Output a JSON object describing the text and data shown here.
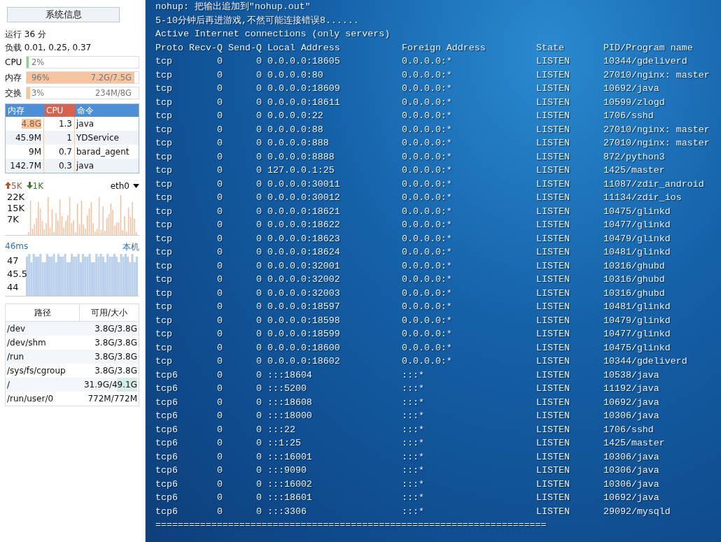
{
  "sidebar": {
    "title_button": "系统信息",
    "uptime": "运行 36 分",
    "load": "负载 0.01, 0.25, 0.37",
    "meters": [
      {
        "label": "CPU",
        "percent": "2%",
        "level": 0.02,
        "color": "#8fd08f"
      },
      {
        "label": "内存",
        "percent": "96%",
        "detail": "7.2G/7.5G",
        "level": 0.96,
        "color": "#f6c49e"
      },
      {
        "label": "交换",
        "percent": "3%",
        "detail": "234M/8G",
        "level": 0.03,
        "color": "#f6c49e"
      }
    ],
    "process_table": {
      "columns": [
        "内存",
        "CPU",
        "命令"
      ],
      "rows": [
        {
          "mem": "4.8G",
          "cpu": "1.3",
          "command": "java",
          "highlighted": true
        },
        {
          "mem": "45.9M",
          "cpu": "1",
          "command": "YDService",
          "highlighted": false
        },
        {
          "mem": "9M",
          "cpu": "0.7",
          "command": "barad_agent",
          "highlighted": false
        },
        {
          "mem": "142.7M",
          "cpu": "0.3",
          "command": "java",
          "highlighted": false
        }
      ]
    },
    "network": {
      "upload": "5K",
      "download": "1K",
      "interface": "eth0",
      "y_labels": [
        "22K",
        "15K",
        "7K"
      ]
    },
    "latency": {
      "value": "46ms",
      "host": "本机",
      "y_labels": [
        "47",
        "45.5",
        "44"
      ]
    },
    "disk_table": {
      "columns": [
        "路径",
        "可用/大小"
      ],
      "rows": [
        {
          "path": "/dev",
          "usage": "3.8G/3.8G",
          "highlighted": false
        },
        {
          "path": "/dev/shm",
          "usage": "3.8G/3.8G",
          "highlighted": false
        },
        {
          "path": "/run",
          "usage": "3.8G/3.8G",
          "highlighted": false
        },
        {
          "path": "/sys/fs/cgroup",
          "usage": "3.8G/3.8G",
          "highlighted": false
        },
        {
          "path": "/",
          "usage": "31.9G/49.1G",
          "highlighted": true
        },
        {
          "path": "/run/user/0",
          "usage": "772M/772M",
          "highlighted": false
        }
      ]
    }
  },
  "terminal": {
    "lines": [
      "nohup: 把输出追加到\"nohup.out\"",
      "5-10分钟后再进游戏,不然可能连接错误8......",
      "Active Internet connections (only servers)"
    ],
    "columns": [
      "Proto",
      "Recv-Q",
      "Send-Q",
      "Local Address",
      "Foreign Address",
      "State",
      "PID/Program name"
    ],
    "rows": [
      [
        "tcp",
        "0",
        "0",
        "0.0.0.0:18605",
        "0.0.0.0:*",
        "LISTEN",
        "10344/gdeliverd"
      ],
      [
        "tcp",
        "0",
        "0",
        "0.0.0.0:80",
        "0.0.0.0:*",
        "LISTEN",
        "27010/nginx: master"
      ],
      [
        "tcp",
        "0",
        "0",
        "0.0.0.0:18609",
        "0.0.0.0:*",
        "LISTEN",
        "10692/java"
      ],
      [
        "tcp",
        "0",
        "0",
        "0.0.0.0:18611",
        "0.0.0.0:*",
        "LISTEN",
        "10599/zlogd"
      ],
      [
        "tcp",
        "0",
        "0",
        "0.0.0.0:22",
        "0.0.0.0:*",
        "LISTEN",
        "1706/sshd"
      ],
      [
        "tcp",
        "0",
        "0",
        "0.0.0.0:88",
        "0.0.0.0:*",
        "LISTEN",
        "27010/nginx: master"
      ],
      [
        "tcp",
        "0",
        "0",
        "0.0.0.0:888",
        "0.0.0.0:*",
        "LISTEN",
        "27010/nginx: master"
      ],
      [
        "tcp",
        "0",
        "0",
        "0.0.0.0:8888",
        "0.0.0.0:*",
        "LISTEN",
        "872/python3"
      ],
      [
        "tcp",
        "0",
        "0",
        "127.0.0.1:25",
        "0.0.0.0:*",
        "LISTEN",
        "1425/master"
      ],
      [
        "tcp",
        "0",
        "0",
        "0.0.0.0:30011",
        "0.0.0.0:*",
        "LISTEN",
        "11087/zdir_android"
      ],
      [
        "tcp",
        "0",
        "0",
        "0.0.0.0:30012",
        "0.0.0.0:*",
        "LISTEN",
        "11134/zdir_ios"
      ],
      [
        "tcp",
        "0",
        "0",
        "0.0.0.0:18621",
        "0.0.0.0:*",
        "LISTEN",
        "10475/glinkd"
      ],
      [
        "tcp",
        "0",
        "0",
        "0.0.0.0:18622",
        "0.0.0.0:*",
        "LISTEN",
        "10477/glinkd"
      ],
      [
        "tcp",
        "0",
        "0",
        "0.0.0.0:18623",
        "0.0.0.0:*",
        "LISTEN",
        "10479/glinkd"
      ],
      [
        "tcp",
        "0",
        "0",
        "0.0.0.0:18624",
        "0.0.0.0:*",
        "LISTEN",
        "10481/glinkd"
      ],
      [
        "tcp",
        "0",
        "0",
        "0.0.0.0:32001",
        "0.0.0.0:*",
        "LISTEN",
        "10316/ghubd"
      ],
      [
        "tcp",
        "0",
        "0",
        "0.0.0.0:32002",
        "0.0.0.0:*",
        "LISTEN",
        "10316/ghubd"
      ],
      [
        "tcp",
        "0",
        "0",
        "0.0.0.0:32003",
        "0.0.0.0:*",
        "LISTEN",
        "10316/ghubd"
      ],
      [
        "tcp",
        "0",
        "0",
        "0.0.0.0:18597",
        "0.0.0.0:*",
        "LISTEN",
        "10481/glinkd"
      ],
      [
        "tcp",
        "0",
        "0",
        "0.0.0.0:18598",
        "0.0.0.0:*",
        "LISTEN",
        "10479/glinkd"
      ],
      [
        "tcp",
        "0",
        "0",
        "0.0.0.0:18599",
        "0.0.0.0:*",
        "LISTEN",
        "10477/glinkd"
      ],
      [
        "tcp",
        "0",
        "0",
        "0.0.0.0:18600",
        "0.0.0.0:*",
        "LISTEN",
        "10475/glinkd"
      ],
      [
        "tcp",
        "0",
        "0",
        "0.0.0.0:18602",
        "0.0.0.0:*",
        "LISTEN",
        "10344/gdeliverd"
      ],
      [
        "tcp6",
        "0",
        "0",
        ":::18604",
        ":::*",
        "LISTEN",
        "10538/java"
      ],
      [
        "tcp6",
        "0",
        "0",
        ":::5200",
        ":::*",
        "LISTEN",
        "11192/java"
      ],
      [
        "tcp6",
        "0",
        "0",
        ":::18608",
        ":::*",
        "LISTEN",
        "10692/java"
      ],
      [
        "tcp6",
        "0",
        "0",
        ":::18000",
        ":::*",
        "LISTEN",
        "10306/java"
      ],
      [
        "tcp6",
        "0",
        "0",
        ":::22",
        ":::*",
        "LISTEN",
        "1706/sshd"
      ],
      [
        "tcp6",
        "0",
        "0",
        "::1:25",
        ":::*",
        "LISTEN",
        "1425/master"
      ],
      [
        "tcp6",
        "0",
        "0",
        ":::16001",
        ":::*",
        "LISTEN",
        "10306/java"
      ],
      [
        "tcp6",
        "0",
        "0",
        ":::9090",
        ":::*",
        "LISTEN",
        "10306/java"
      ],
      [
        "tcp6",
        "0",
        "0",
        ":::16002",
        ":::*",
        "LISTEN",
        "10306/java"
      ],
      [
        "tcp6",
        "0",
        "0",
        ":::18601",
        ":::*",
        "LISTEN",
        "10692/java"
      ],
      [
        "tcp6",
        "0",
        "0",
        ":::3306",
        ":::*",
        "LISTEN",
        "29092/mysqld"
      ]
    ],
    "separator": "======================================================================"
  }
}
